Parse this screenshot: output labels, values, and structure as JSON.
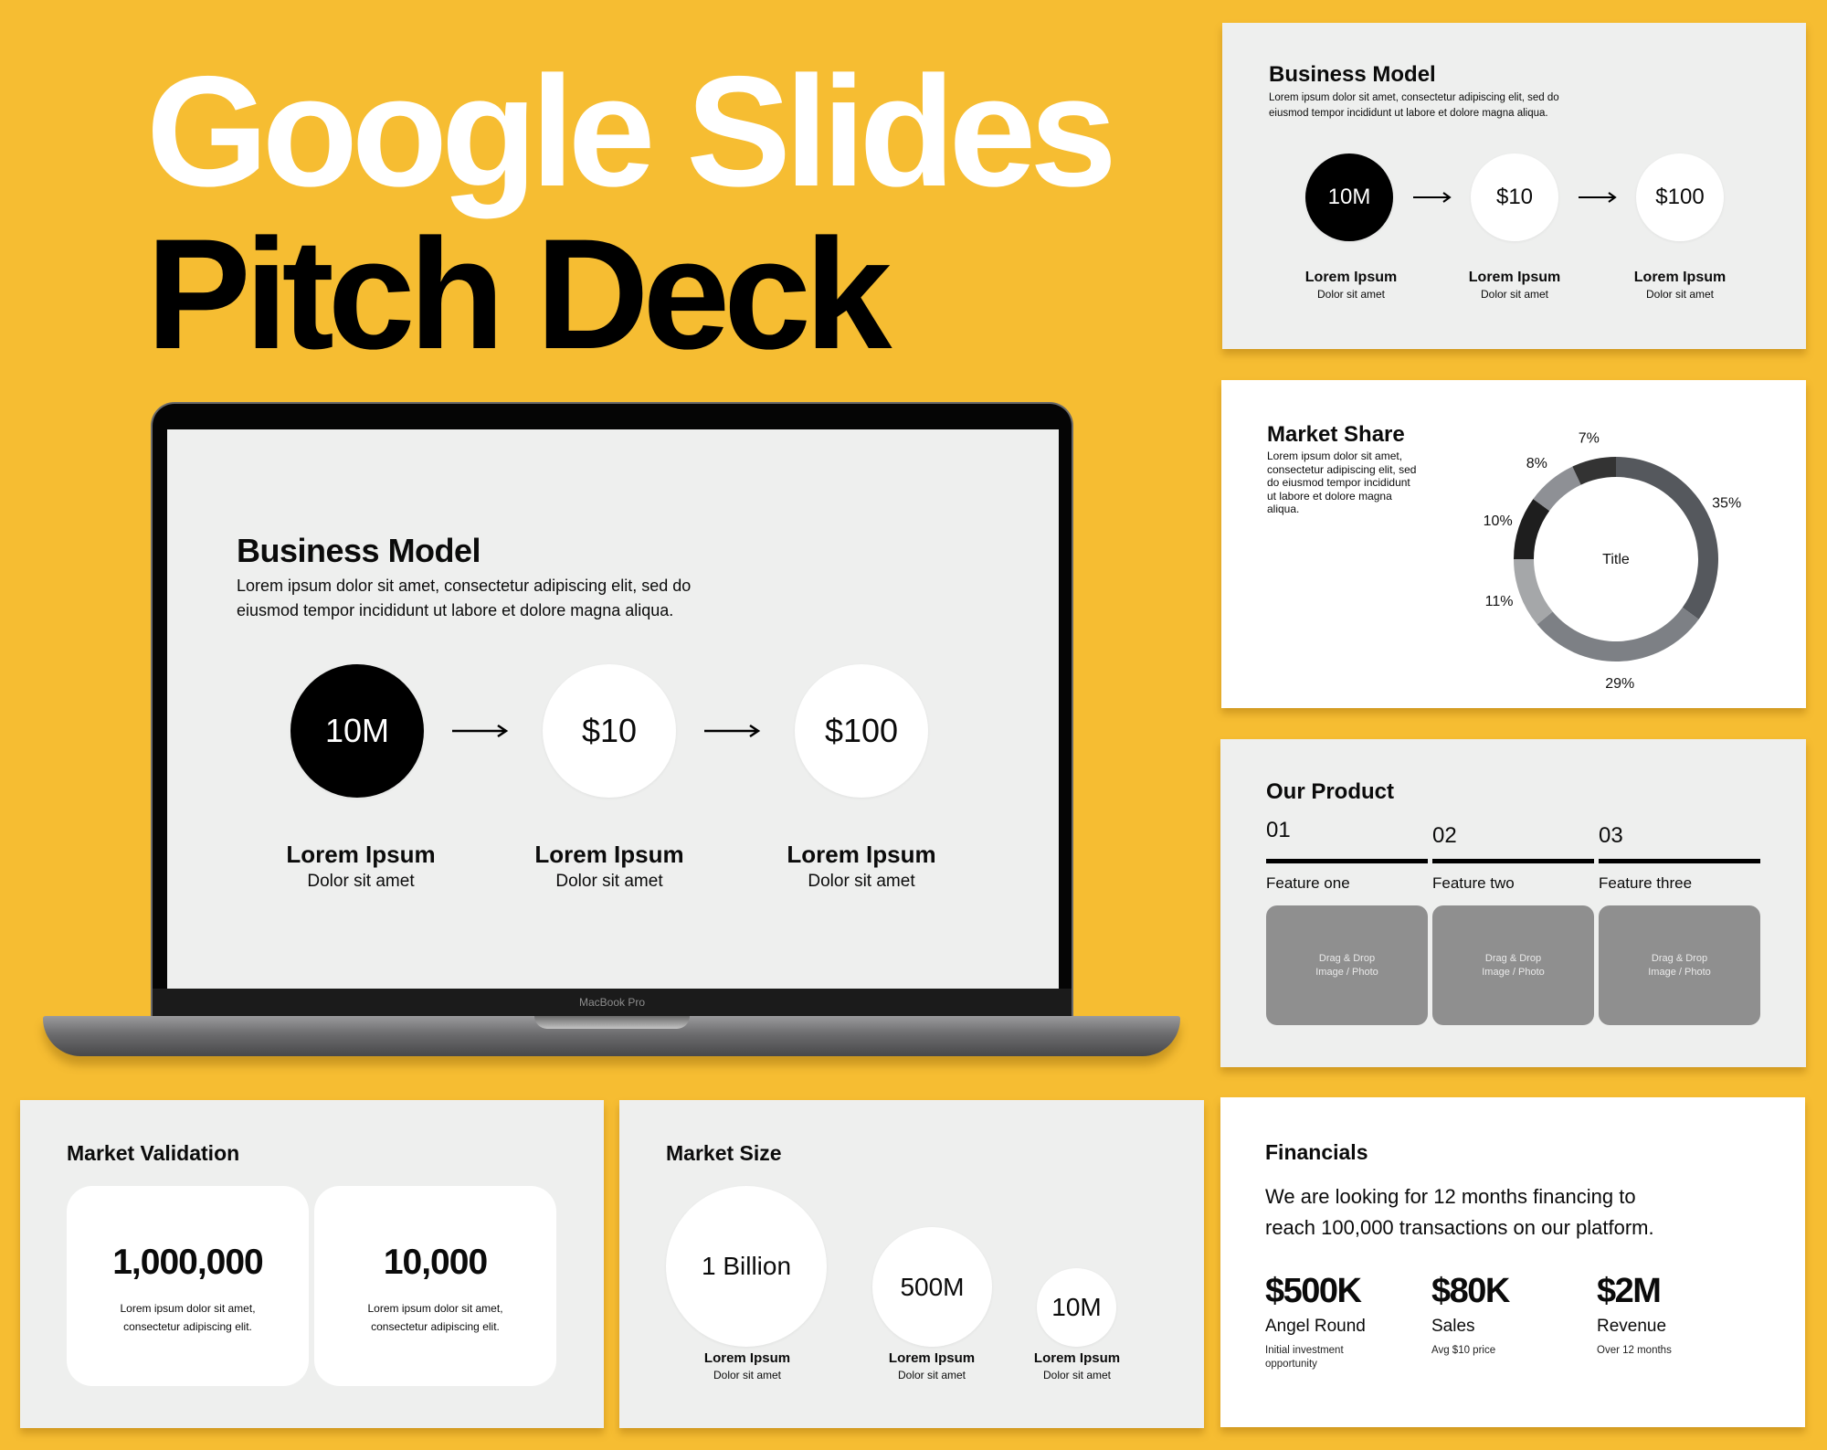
{
  "hero": {
    "line1": "Google Slides",
    "line2": "Pitch Deck"
  },
  "colors": {
    "background": "#F6BD32",
    "slide_gray": "#EEEFEE",
    "placeholder": "#8F8F8F"
  },
  "laptop": {
    "brand_label": "MacBook Pro",
    "slide": {
      "title": "Business Model",
      "body_line1": "Lorem ipsum dolor sit amet, consectetur adipiscing elit, sed do",
      "body_line2": "eiusmod tempor incididunt ut labore et dolore magna aliqua.",
      "steps": [
        {
          "value": "10M",
          "label": "Lorem Ipsum",
          "sub": "Dolor sit amet"
        },
        {
          "value": "$10",
          "label": "Lorem Ipsum",
          "sub": "Dolor sit amet"
        },
        {
          "value": "$100",
          "label": "Lorem Ipsum",
          "sub": "Dolor sit amet"
        }
      ]
    }
  },
  "business_model": {
    "title": "Business Model",
    "body_line1": "Lorem ipsum dolor sit amet, consectetur adipiscing elit, sed do",
    "body_line2": "eiusmod tempor incididunt ut labore et dolore magna aliqua.",
    "steps": [
      {
        "value": "10M",
        "label": "Lorem Ipsum",
        "sub": "Dolor sit amet"
      },
      {
        "value": "$10",
        "label": "Lorem Ipsum",
        "sub": "Dolor sit amet"
      },
      {
        "value": "$100",
        "label": "Lorem Ipsum",
        "sub": "Dolor sit amet"
      }
    ]
  },
  "market_share": {
    "title": "Market Share",
    "body": [
      "Lorem ipsum dolor sit amet,",
      "consectetur adipiscing elit, sed",
      "do eiusmod tempor incididunt",
      "ut labore et dolore magna",
      "aliqua."
    ]
  },
  "chart_data": {
    "type": "pie",
    "variant": "donut",
    "title": "Title",
    "slices": [
      {
        "label": "35%",
        "value": 35,
        "color": "#55585D"
      },
      {
        "label": "29%",
        "value": 29,
        "color": "#7D8085"
      },
      {
        "label": "11%",
        "value": 11,
        "color": "#A5A7A9"
      },
      {
        "label": "10%",
        "value": 10,
        "color": "#1E1E1E"
      },
      {
        "label": "8%",
        "value": 8,
        "color": "#8E9095"
      },
      {
        "label": "7%",
        "value": 7,
        "color": "#333333"
      }
    ],
    "start": "top",
    "direction": "clockwise"
  },
  "our_product": {
    "title": "Our Product",
    "features": [
      {
        "num": "01",
        "name": "Feature one",
        "placeholder_l1": "Drag & Drop",
        "placeholder_l2": "Image / Photo"
      },
      {
        "num": "02",
        "name": "Feature two",
        "placeholder_l1": "Drag & Drop",
        "placeholder_l2": "Image / Photo"
      },
      {
        "num": "03",
        "name": "Feature three",
        "placeholder_l1": "Drag & Drop",
        "placeholder_l2": "Image / Photo"
      }
    ]
  },
  "market_validation": {
    "title": "Market Validation",
    "boxes": [
      {
        "value": "1,000,000",
        "line1": "Lorem ipsum dolor sit amet,",
        "line2": "consectetur adipiscing elit."
      },
      {
        "value": "10,000",
        "line1": "Lorem ipsum dolor sit amet,",
        "line2": "consectetur adipiscing elit."
      }
    ]
  },
  "market_size": {
    "title": "Market Size",
    "items": [
      {
        "value": "1 Billion",
        "label": "Lorem Ipsum",
        "sub": "Dolor sit amet"
      },
      {
        "value": "500M",
        "label": "Lorem Ipsum",
        "sub": "Dolor sit amet"
      },
      {
        "value": "10M",
        "label": "Lorem Ipsum",
        "sub": "Dolor sit amet"
      }
    ]
  },
  "financials": {
    "title": "Financials",
    "body_line1": "We are looking for 12 months financing to",
    "body_line2": "reach 100,000 transactions on our platform.",
    "metrics": [
      {
        "value": "$500K",
        "label": "Angel Round",
        "note_l1": "Initial investment",
        "note_l2": "opportunity"
      },
      {
        "value": "$80K",
        "label": "Sales",
        "note_l1": "Avg $10 price",
        "note_l2": ""
      },
      {
        "value": "$2M",
        "label": "Revenue",
        "note_l1": "Over 12 months",
        "note_l2": ""
      }
    ]
  }
}
